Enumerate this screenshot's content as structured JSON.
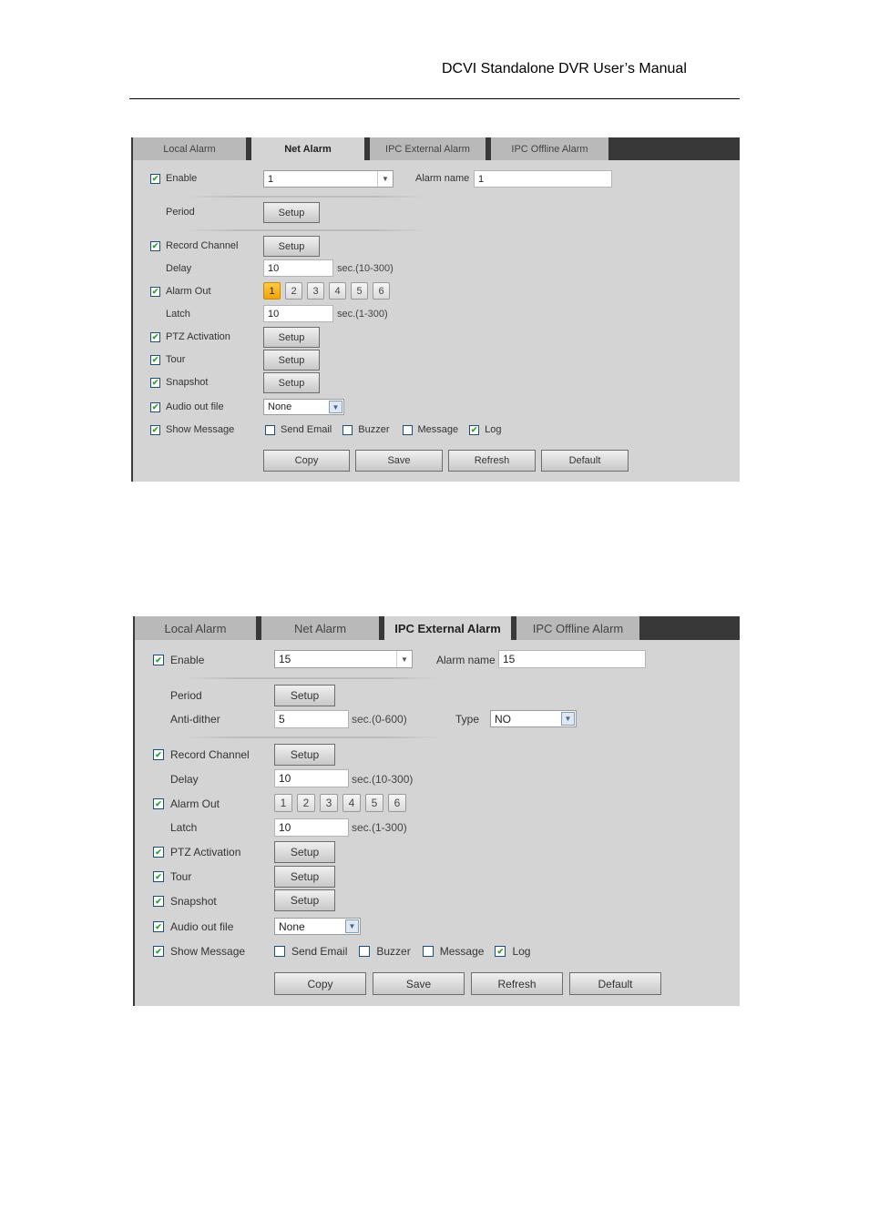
{
  "document": {
    "header_title": "DCVI Standalone DVR User’s Manual"
  },
  "icons": {
    "checkbox_checked": "✔",
    "dropdown_arrow": "▼"
  },
  "colors": {
    "tab_bar_bg": "#383838",
    "panel_bg": "#d4d4d4",
    "alarm_out_active": "#f5a800",
    "check_green": "#2ea12e"
  },
  "panel1": {
    "tabs": [
      {
        "label": "Local Alarm",
        "active": false
      },
      {
        "label": "Net Alarm",
        "active": true
      },
      {
        "label": "IPC External Alarm",
        "active": false
      },
      {
        "label": "IPC Offline Alarm",
        "active": false
      }
    ],
    "enable": {
      "label": "Enable",
      "checked": true,
      "value": "1"
    },
    "alarm_name": {
      "label": "Alarm name",
      "value": "1"
    },
    "period": {
      "label": "Period",
      "button": "Setup"
    },
    "record_channel": {
      "label": "Record Channel",
      "checked": true,
      "button": "Setup"
    },
    "delay": {
      "label": "Delay",
      "value": "10",
      "hint": "sec.(10-300)"
    },
    "alarm_out": {
      "label": "Alarm Out",
      "checked": true,
      "channels": [
        "1",
        "2",
        "3",
        "4",
        "5",
        "6"
      ],
      "selected": [
        "1"
      ]
    },
    "latch": {
      "label": "Latch",
      "value": "10",
      "hint": "sec.(1-300)"
    },
    "ptz_activation": {
      "label": "PTZ Activation",
      "checked": true,
      "button": "Setup"
    },
    "tour": {
      "label": "Tour",
      "checked": true,
      "button": "Setup"
    },
    "snapshot": {
      "label": "Snapshot",
      "checked": true,
      "button": "Setup"
    },
    "audio_out_file": {
      "label": "Audio out file",
      "checked": true,
      "value": "None"
    },
    "show_message": {
      "label": "Show Message",
      "checked": true
    },
    "send_email": {
      "label": "Send Email",
      "checked": false
    },
    "buzzer": {
      "label": "Buzzer",
      "checked": false
    },
    "message": {
      "label": "Message",
      "checked": false
    },
    "log": {
      "label": "Log",
      "checked": true
    },
    "actions": {
      "copy": "Copy",
      "save": "Save",
      "refresh": "Refresh",
      "default": "Default"
    }
  },
  "panel2": {
    "tabs": [
      {
        "label": "Local Alarm",
        "active": false
      },
      {
        "label": "Net Alarm",
        "active": false
      },
      {
        "label": "IPC External Alarm",
        "active": true
      },
      {
        "label": "IPC Offline Alarm",
        "active": false
      }
    ],
    "enable": {
      "label": "Enable",
      "checked": true,
      "value": "15"
    },
    "alarm_name": {
      "label": "Alarm name",
      "value": "15"
    },
    "period": {
      "label": "Period",
      "button": "Setup"
    },
    "anti_dither": {
      "label": "Anti-dither",
      "value": "5",
      "hint": "sec.(0-600)"
    },
    "type": {
      "label": "Type",
      "value": "NO"
    },
    "record_channel": {
      "label": "Record Channel",
      "checked": true,
      "button": "Setup"
    },
    "delay": {
      "label": "Delay",
      "value": "10",
      "hint": "sec.(10-300)"
    },
    "alarm_out": {
      "label": "Alarm Out",
      "checked": true,
      "channels": [
        "1",
        "2",
        "3",
        "4",
        "5",
        "6"
      ],
      "selected": []
    },
    "latch": {
      "label": "Latch",
      "value": "10",
      "hint": "sec.(1-300)"
    },
    "ptz_activation": {
      "label": "PTZ Activation",
      "checked": true,
      "button": "Setup"
    },
    "tour": {
      "label": "Tour",
      "checked": true,
      "button": "Setup"
    },
    "snapshot": {
      "label": "Snapshot",
      "checked": true,
      "button": "Setup"
    },
    "audio_out_file": {
      "label": "Audio out file",
      "checked": true,
      "value": "None"
    },
    "show_message": {
      "label": "Show Message",
      "checked": true
    },
    "send_email": {
      "label": "Send Email",
      "checked": false
    },
    "buzzer": {
      "label": "Buzzer",
      "checked": false
    },
    "message": {
      "label": "Message",
      "checked": false
    },
    "log": {
      "label": "Log",
      "checked": true
    },
    "actions": {
      "copy": "Copy",
      "save": "Save",
      "refresh": "Refresh",
      "default": "Default"
    }
  }
}
